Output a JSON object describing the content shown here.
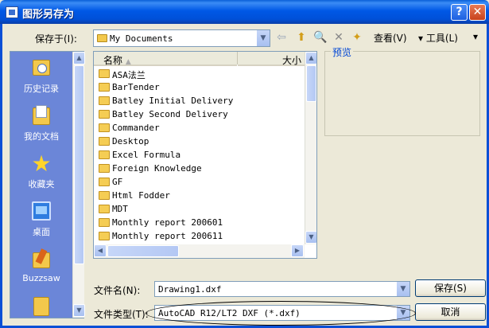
{
  "window": {
    "title": "图形另存为",
    "help_label": "?",
    "close_label": "✕"
  },
  "save_in": {
    "label": "保存于(I):",
    "value": "My Documents"
  },
  "toolbar": {
    "icons": [
      "back-icon",
      "up-folder-icon",
      "search-web-icon",
      "delete-icon",
      "new-folder-icon"
    ],
    "view_label": "查看(V)",
    "tools_label": "▾ 工具(L)",
    "more_label": "▾"
  },
  "places": [
    {
      "label": "历史记录",
      "icon": "history-icon"
    },
    {
      "label": "我的文档",
      "icon": "my-documents-icon"
    },
    {
      "label": "收藏夹",
      "icon": "favorites-icon"
    },
    {
      "label": "桌面",
      "icon": "desktop-icon"
    },
    {
      "label": "Buzzsaw",
      "icon": "buzzsaw-icon"
    },
    {
      "label": "",
      "icon": "more-places-icon"
    }
  ],
  "file_list": {
    "columns": {
      "name": "名称",
      "size": "大小"
    },
    "items": [
      "ASA法兰",
      "BarTender",
      "Batley Initial Delivery",
      "Batley Second Delivery",
      "Commander",
      "Desktop",
      "Excel Formula",
      "Foreign Knowledge",
      "GF",
      "Html Fodder",
      "MDT",
      "Monthly report 200601",
      "Monthly report 200611"
    ]
  },
  "preview": {
    "label": "预览"
  },
  "file_name": {
    "label": "文件名(N):",
    "value": "Drawing1.dxf"
  },
  "file_type": {
    "label": "文件类型(T):",
    "value": "AutoCAD R12/LT2 DXF (*.dxf)"
  },
  "buttons": {
    "save": "保存(S)",
    "cancel": "取消"
  },
  "colors": {
    "titlebar": "#0058e6",
    "places_bar": "#6b86d8",
    "dialog_bg": "#ece9d8"
  }
}
